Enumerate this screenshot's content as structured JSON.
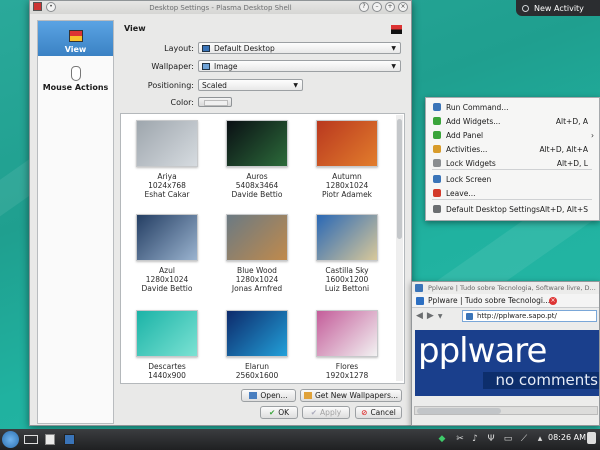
{
  "new_activity": {
    "label": "New Activity"
  },
  "dialog": {
    "title": "Desktop Settings - Plasma Desktop Shell",
    "sidebar": [
      {
        "label": "View",
        "active": true
      },
      {
        "label": "Mouse Actions",
        "active": false
      }
    ],
    "page_title": "View",
    "form": {
      "layout_label": "Layout:",
      "layout_value": "Default Desktop",
      "wallpaper_label": "Wallpaper:",
      "wallpaper_value": "Image",
      "positioning_label": "Positioning:",
      "positioning_value": "Scaled",
      "color_label": "Color:"
    },
    "wallpapers": [
      {
        "name": "Ariya",
        "size": "1024x768",
        "author": "Eshat Cakar",
        "colors": [
          "#9ea6ad",
          "#d6dbe0"
        ]
      },
      {
        "name": "Auros",
        "size": "5408x3464",
        "author": "Davide Bettio",
        "colors": [
          "#0a0f14",
          "#2c6b3a"
        ]
      },
      {
        "name": "Autumn",
        "size": "1280x1024",
        "author": "Piotr Adamek",
        "colors": [
          "#b9381f",
          "#e27d2c"
        ]
      },
      {
        "name": "Azul",
        "size": "1280x1024",
        "author": "Davide Bettio",
        "colors": [
          "#243e63",
          "#9ab3cf"
        ]
      },
      {
        "name": "Blue Wood",
        "size": "1280x1024",
        "author": "Jonas Arnfred",
        "colors": [
          "#6b7a83",
          "#c08a4c"
        ]
      },
      {
        "name": "Castilla Sky",
        "size": "1600x1200",
        "author": "Luiz Bettoni",
        "colors": [
          "#2a68b5",
          "#d8c89a"
        ]
      },
      {
        "name": "Descartes",
        "size": "1440x900",
        "author": "",
        "colors": [
          "#1bb3a7",
          "#7be2d3"
        ]
      },
      {
        "name": "Elarun",
        "size": "2560x1600",
        "author": "",
        "colors": [
          "#0d2a6b",
          "#22a0d9"
        ]
      },
      {
        "name": "Flores",
        "size": "1920x1278",
        "author": "",
        "colors": [
          "#c45d9a",
          "#f2f2f2"
        ]
      }
    ],
    "buttons": {
      "open": "Open...",
      "get_new": "Get New Wallpapers...",
      "ok": "OK",
      "apply": "Apply",
      "cancel": "Cancel"
    }
  },
  "context_menu": [
    {
      "label": "Run Command...",
      "shortcut": "",
      "icon_color": "#3a74b8",
      "icon": "run-command-icon"
    },
    {
      "label": "Add Widgets...",
      "shortcut": "Alt+D, A",
      "icon_color": "#3aa43a",
      "icon": "add-widgets-icon"
    },
    {
      "label": "Add Panel",
      "shortcut": "",
      "icon_color": "#3aa43a",
      "icon": "add-panel-icon",
      "submenu": true
    },
    {
      "label": "Activities...",
      "shortcut": "Alt+D, Alt+A",
      "icon_color": "#d89b2a",
      "icon": "activities-icon"
    },
    {
      "label": "Lock Widgets",
      "shortcut": "Alt+D, L",
      "icon_color": "#8a8d90",
      "icon": "lock-widgets-icon"
    },
    {
      "label": "Lock Screen",
      "shortcut": "",
      "icon_color": "#3a74b8",
      "icon": "lock-screen-icon"
    },
    {
      "label": "Leave...",
      "shortcut": "",
      "icon_color": "#d33a2a",
      "icon": "leave-icon"
    },
    {
      "label": "Default Desktop Settings",
      "shortcut": "Alt+D, Alt+S",
      "icon_color": "#6b6e70",
      "icon": "settings-icon"
    }
  ],
  "browser": {
    "window_title": "Pplware | Tudo sobre Tecnologia, Software livre, D...",
    "tab_title": "Pplware | Tudo sobre Tecnologi...",
    "url": "http://pplware.sapo.pt/",
    "logo": "pplware",
    "tagline": "no comments"
  },
  "taskbar": {
    "clock": "08:26 AM"
  }
}
